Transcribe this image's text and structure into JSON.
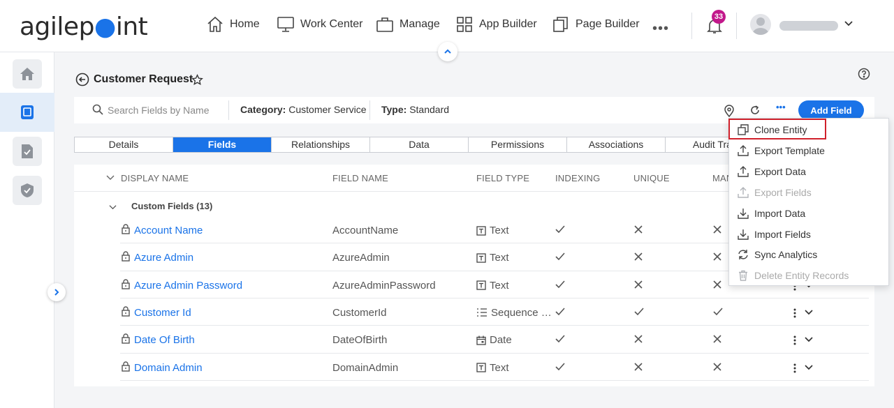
{
  "app": {
    "logo_text_a": "agilep",
    "logo_text_b": "int"
  },
  "nav": {
    "home": "Home",
    "work_center": "Work Center",
    "manage": "Manage",
    "app_builder": "App Builder",
    "page_builder": "Page Builder",
    "more": "•••",
    "notifications_count": "33"
  },
  "header": {
    "title": "Customer Request"
  },
  "toolbar": {
    "search_placeholder": "Search Fields by Name",
    "category_label": "Category:",
    "category_value": "Customer Service",
    "type_label": "Type:",
    "type_value": "Standard",
    "more": "•••",
    "add_field": "Add Field"
  },
  "tabs": [
    "Details",
    "Fields",
    "Relationships",
    "Data",
    "Permissions",
    "Associations",
    "Audit Trail"
  ],
  "active_tab": "Fields",
  "table": {
    "columns": [
      "DISPLAY NAME",
      "FIELD NAME",
      "FIELD TYPE",
      "INDEXING",
      "UNIQUE",
      "MAN"
    ],
    "group": "Custom Fields (13)",
    "rows": [
      {
        "display": "Account Name",
        "field": "AccountName",
        "type": "Text",
        "type_icon": "text-type-icon",
        "indexing": "check",
        "unique": "x",
        "mandatory": "x"
      },
      {
        "display": "Azure Admin",
        "field": "AzureAdmin",
        "type": "Text",
        "type_icon": "text-type-icon",
        "indexing": "check",
        "unique": "x",
        "mandatory": "x"
      },
      {
        "display": "Azure Admin Password",
        "field": "AzureAdminPassword",
        "type": "Text",
        "type_icon": "text-type-icon",
        "indexing": "check",
        "unique": "x",
        "mandatory": "x"
      },
      {
        "display": "Customer Id",
        "field": "CustomerId",
        "type": "Sequence …",
        "type_icon": "sequence-type-icon",
        "indexing": "check",
        "unique": "check",
        "mandatory": "check"
      },
      {
        "display": "Date Of Birth",
        "field": "DateOfBirth",
        "type": "Date",
        "type_icon": "date-type-icon",
        "indexing": "check",
        "unique": "x",
        "mandatory": "x"
      },
      {
        "display": "Domain Admin",
        "field": "DomainAdmin",
        "type": "Text",
        "type_icon": "text-type-icon",
        "indexing": "check",
        "unique": "x",
        "mandatory": "x"
      }
    ]
  },
  "menu": {
    "items": [
      {
        "label": "Clone Entity",
        "icon": "clone-icon",
        "disabled": false
      },
      {
        "label": "Export Template",
        "icon": "export-icon",
        "disabled": false
      },
      {
        "label": "Export Data",
        "icon": "export-icon",
        "disabled": false
      },
      {
        "label": "Export Fields",
        "icon": "export-icon",
        "disabled": true
      },
      {
        "label": "Import Data",
        "icon": "import-icon",
        "disabled": false
      },
      {
        "label": "Import Fields",
        "icon": "import-icon",
        "disabled": false
      },
      {
        "label": "Sync Analytics",
        "icon": "sync-icon",
        "disabled": false
      },
      {
        "label": "Delete Entity Records",
        "icon": "trash-icon",
        "disabled": true
      }
    ]
  },
  "colors": {
    "accent": "#1a73e8",
    "badge": "#c2188b",
    "highlight": "#d0202b"
  }
}
